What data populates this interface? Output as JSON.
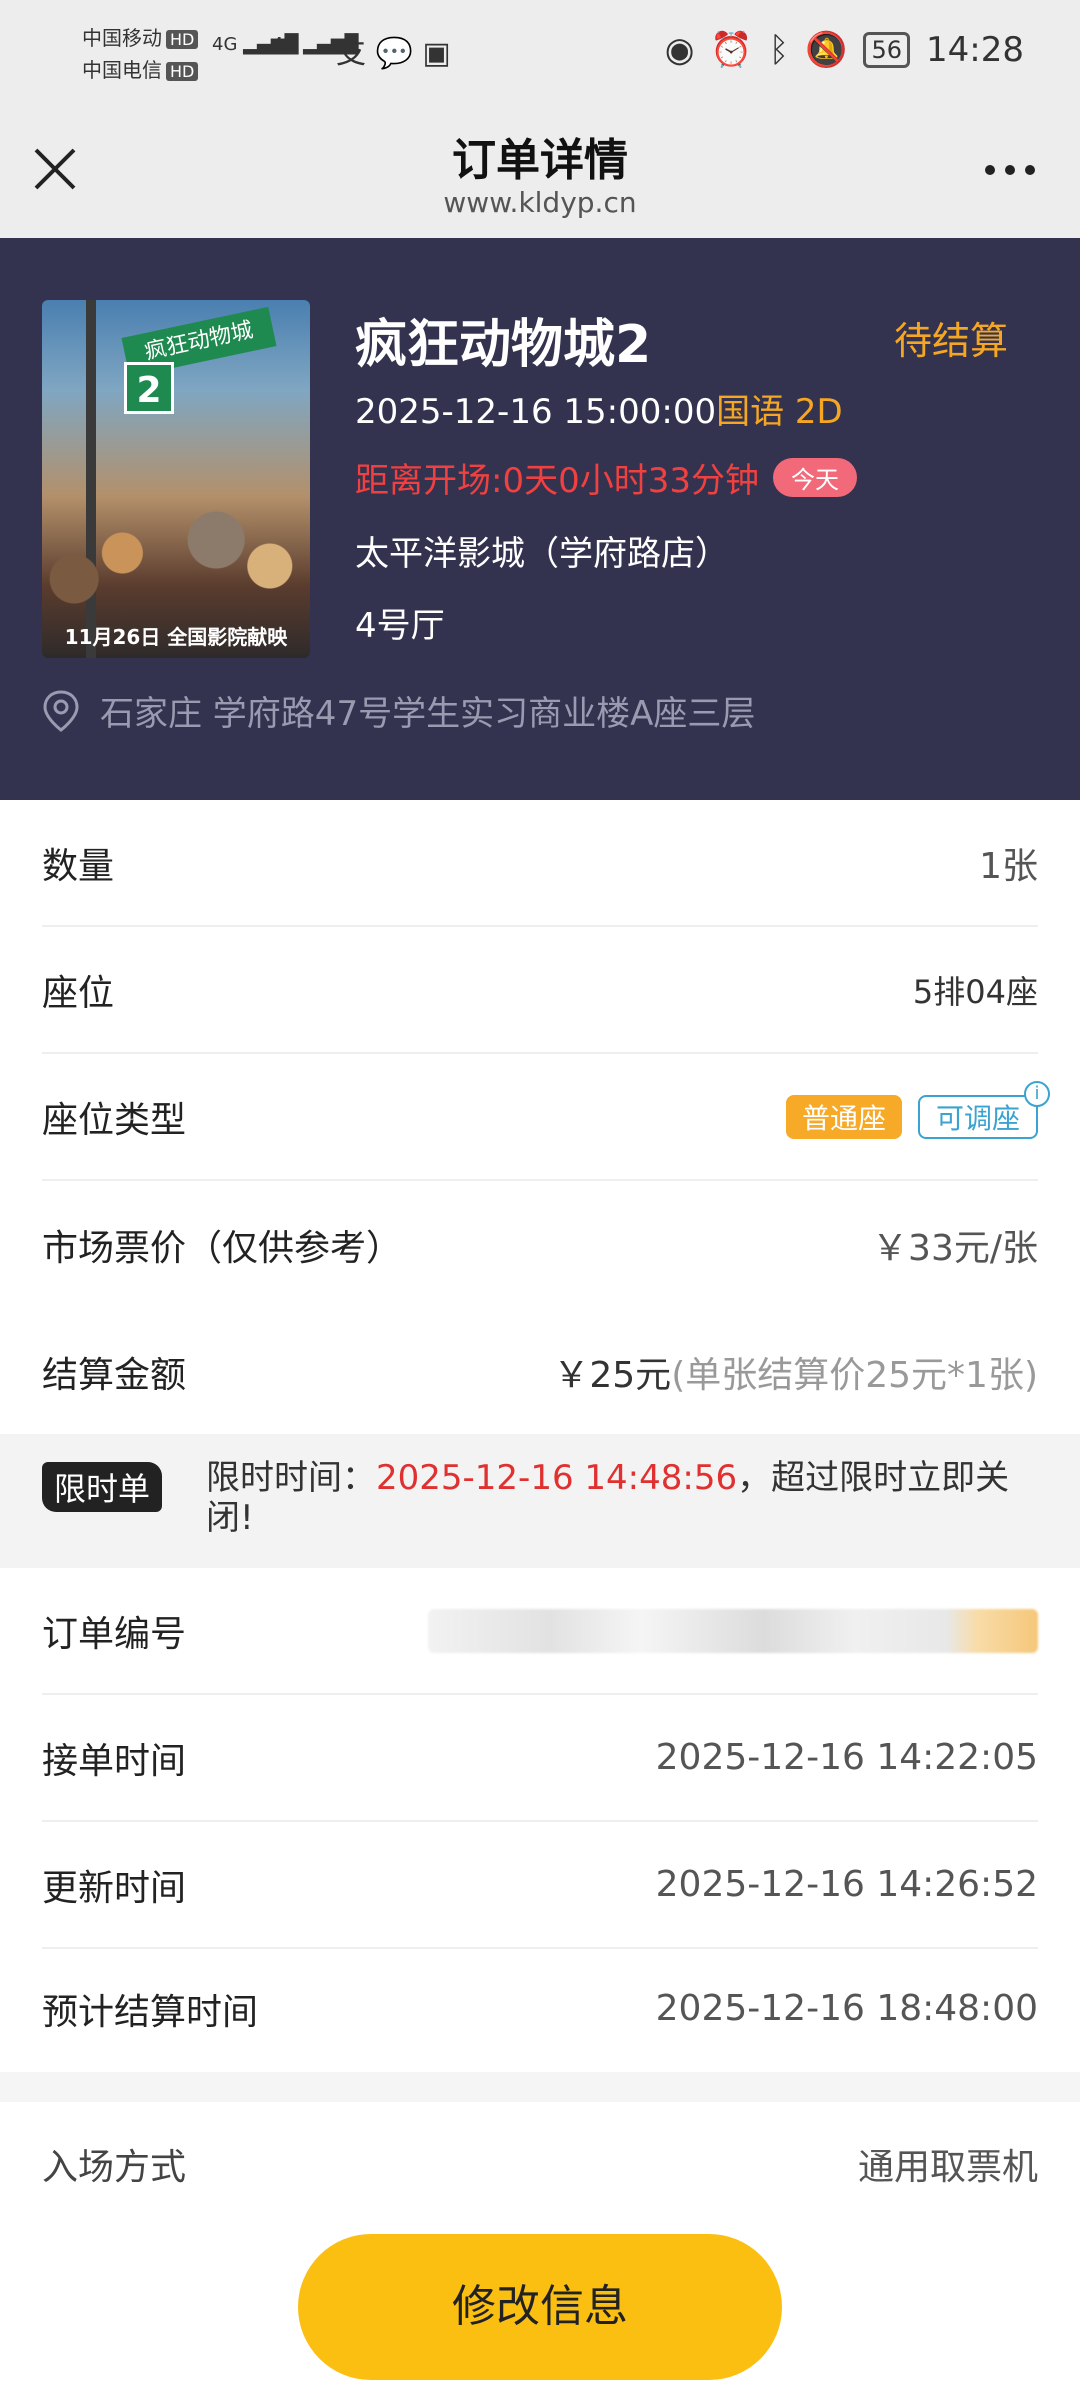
{
  "status_bar": {
    "carrier1": "中国移动",
    "carrier2": "中国电信",
    "hd": "HD",
    "net1": "4G",
    "net2": "4G",
    "battery": "56",
    "time": "14:28"
  },
  "nav": {
    "title": "订单详情",
    "subtitle": "www.kldyp.cn"
  },
  "movie": {
    "title": "疯狂动物城2",
    "status": "待结算",
    "datetime": "2025-12-16 15:00:00",
    "language_format": "国语 2D",
    "countdown": "距离开场:0天0小时33分钟",
    "today_badge": "今天",
    "cinema": "太平洋影城（学府路店）",
    "hall": "4号厅",
    "address": "石家庄  学府路47号学生实习商业楼A座三层",
    "poster": {
      "sign_text": "疯狂动物城",
      "number": "2",
      "release_date": "11月26日 全国影院献映"
    }
  },
  "details": {
    "quantity_label": "数量",
    "quantity_value": "1张",
    "seat_label": "座位",
    "seat_value": "5排04座",
    "seat_type_label": "座位类型",
    "seat_type_badge": "普通座",
    "seat_adjustable_badge": "可调座",
    "market_price_label": "市场票价（仅供参考）",
    "market_price_value": "￥33元/张",
    "settle_amount_label": "结算金额",
    "settle_amount_value": "￥25元",
    "settle_amount_detail": "(单张结算价25元*1张)"
  },
  "limit": {
    "tag": "限时单",
    "prefix": "限时时间：",
    "time": "2025-12-16 14:48:56",
    "suffix": "，超过限时立即关闭!"
  },
  "order": {
    "order_no_label": "订单编号",
    "accept_time_label": "接单时间",
    "accept_time_value": "2025-12-16 14:22:05",
    "update_time_label": "更新时间",
    "update_time_value": "2025-12-16 14:26:52",
    "expected_settle_label": "预计结算时间",
    "expected_settle_value": "2025-12-16 18:48:00",
    "entry_label": "入场方式",
    "entry_value": "通用取票机"
  },
  "actions": {
    "modify": "修改信息"
  },
  "colors": {
    "header_bg": "#333350",
    "accent_orange": "#f5a623",
    "countdown_red": "#f04040",
    "button_yellow": "#fbbf12"
  }
}
